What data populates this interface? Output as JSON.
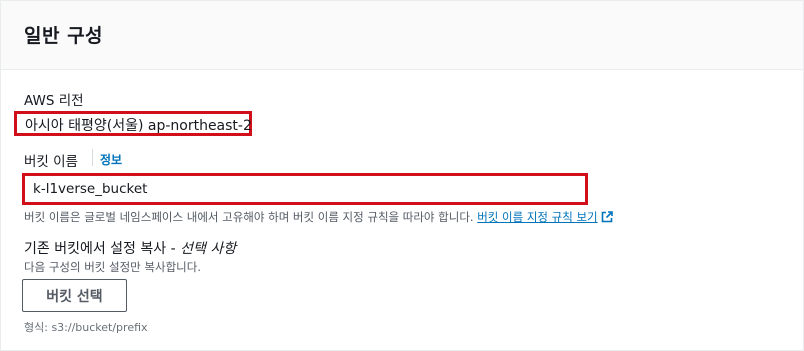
{
  "panel": {
    "title": "일반 구성"
  },
  "region": {
    "label": "AWS 리전",
    "value": "아시아 태평양(서울) ap-northeast-2"
  },
  "bucket_name": {
    "label": "버킷 이름",
    "info_link": "정보",
    "value": "k-l1verse_bucket",
    "hint": "버킷 이름은 글로벌 네임스페이스 내에서 고유해야 하며 버킷 이름 지정 규칙을 따라야 합니다.",
    "rules_link": "버킷 이름 지정 규칙 보기"
  },
  "copy_settings": {
    "title": "기존 버킷에서 설정 복사 -",
    "optional": "선택 사항",
    "description": "다음 구성의 버킷 설정만 복사합니다.",
    "button_label": "버킷 선택",
    "format_hint": "형식: s3://bucket/prefix"
  },
  "colors": {
    "highlight_box": "#d10f1a",
    "link": "#0073bb"
  },
  "icons": {
    "external_link": "external-link-icon"
  }
}
